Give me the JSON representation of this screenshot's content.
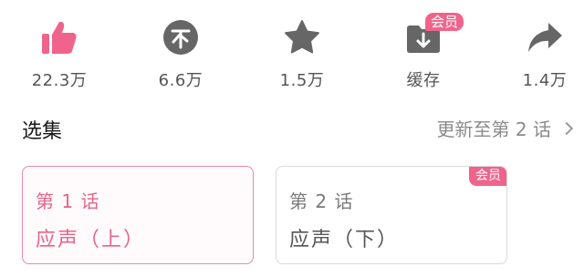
{
  "actions": {
    "like": {
      "label": "22.3万",
      "icon": "thumbs-up-icon",
      "color": "#f0648c"
    },
    "coin": {
      "label": "6.6万",
      "icon": "coin-icon",
      "color": "#666666"
    },
    "fav": {
      "label": "1.5万",
      "icon": "star-icon",
      "color": "#666666"
    },
    "cache": {
      "label": "缓存",
      "icon": "download-icon",
      "color": "#666666",
      "badge": "会员"
    },
    "share": {
      "label": "1.4万",
      "icon": "share-icon",
      "color": "#666666"
    }
  },
  "section": {
    "title": "选集",
    "update_text": "更新至第 2 话"
  },
  "episodes": [
    {
      "number": "第 1 话",
      "title": "应声（上）",
      "selected": true
    },
    {
      "number": "第 2 话",
      "title": "应声（下）",
      "selected": false,
      "badge": "会员"
    }
  ],
  "colors": {
    "accent": "#f0648c",
    "icon_gray": "#666666",
    "muted_text": "#8a8a8a"
  }
}
